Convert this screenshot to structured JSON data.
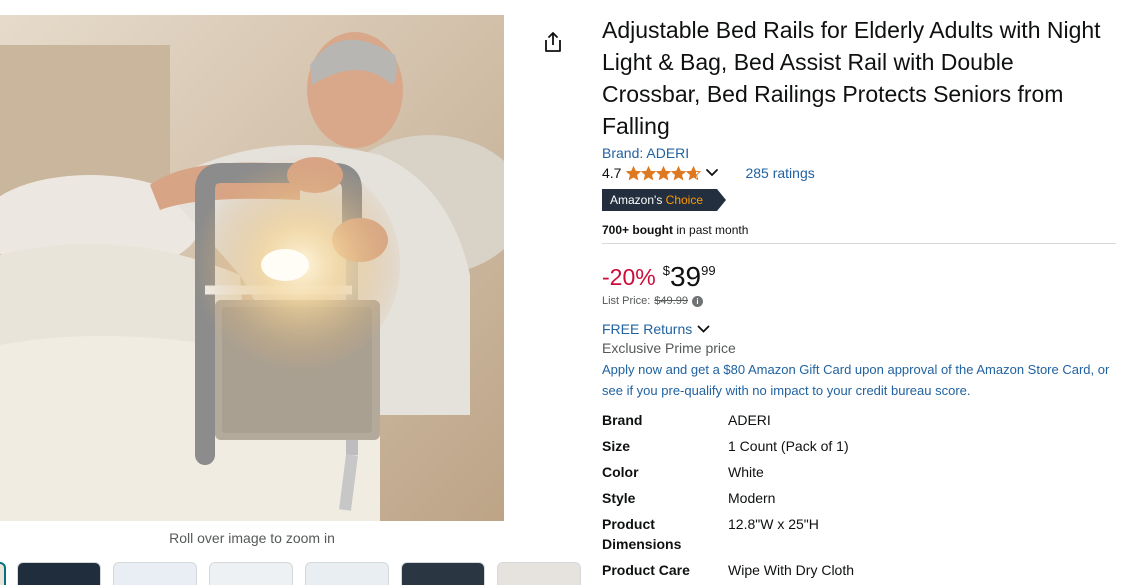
{
  "product": {
    "title": "Adjustable Bed Rails for Elderly Adults with Night Light & Bag, Bed Assist Rail with Double Crossbar, Bed Railings Protects Seniors from Falling",
    "brand_link": "Brand: ADERI",
    "rating_value": "4.7",
    "rating_stars": 4.7,
    "ratings_count": "285 ratings",
    "badge_prefix": "Amazon's",
    "badge_suffix": "Choice",
    "bought_bold": "700+ bought",
    "bought_rest": " in past month"
  },
  "price": {
    "discount": "-20%",
    "symbol": "$",
    "whole": "39",
    "fraction": "99",
    "list_label": "List Price:",
    "list_value": "$49.99"
  },
  "offers": {
    "returns": "FREE Returns",
    "prime_price": "Exclusive Prime price",
    "store_card": "Apply now and get a $80 Amazon Gift Card upon approval of the Amazon Store Card, or see if you pre-qualify with no impact to your credit bureau score."
  },
  "specs": [
    {
      "key": "Brand",
      "value": "ADERI"
    },
    {
      "key": "Size",
      "value": "1 Count (Pack of 1)"
    },
    {
      "key": "Color",
      "value": "White"
    },
    {
      "key": "Style",
      "value": "Modern"
    },
    {
      "key": "Product Dimensions",
      "value": "12.8\"W x 25\"H"
    },
    {
      "key": "Product Care",
      "value": "Wipe With Dry Cloth"
    }
  ],
  "gallery": {
    "zoom_hint": "Roll over image to zoom in"
  },
  "colors": {
    "link": "#2162a1",
    "discount": "#cc0c39",
    "badge_bg": "#232f3e",
    "badge_accent": "#ff9900",
    "star": "#de7921"
  },
  "icons": [
    "share-icon",
    "star-icon",
    "chevron-down-icon",
    "info-icon"
  ]
}
